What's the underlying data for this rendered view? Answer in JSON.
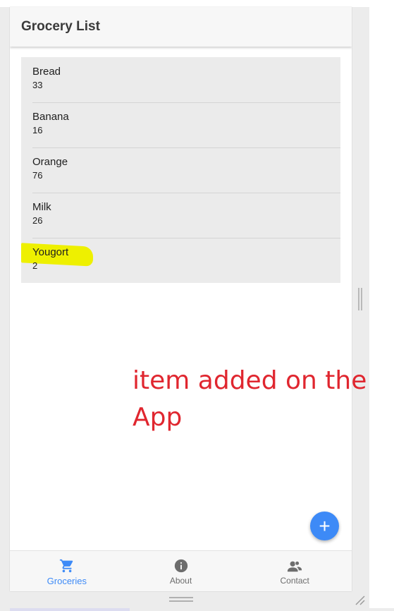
{
  "app": {
    "title": "Grocery List"
  },
  "groceries": [
    {
      "name": "Bread",
      "quantity": "33"
    },
    {
      "name": "Banana",
      "quantity": "16"
    },
    {
      "name": "Orange",
      "quantity": "76"
    },
    {
      "name": "Milk",
      "quantity": "26"
    },
    {
      "name": "Yougort",
      "quantity": "2"
    }
  ],
  "fab": {
    "icon": "plus-icon",
    "symbol": "+"
  },
  "bottom_nav": {
    "items": [
      {
        "label": "Groceries",
        "icon": "cart-icon",
        "active": true
      },
      {
        "label": "About",
        "icon": "info-icon",
        "active": false
      },
      {
        "label": "Contact",
        "icon": "contacts-icon",
        "active": false
      }
    ]
  },
  "annotation": {
    "line1": "item added on the",
    "line2": "App"
  },
  "colors": {
    "accent": "#3d8af7",
    "annotation": "#e0262f",
    "highlight": "#eef000",
    "list_bg": "#ebebeb",
    "app_bar_bg": "#f7f7f7"
  }
}
